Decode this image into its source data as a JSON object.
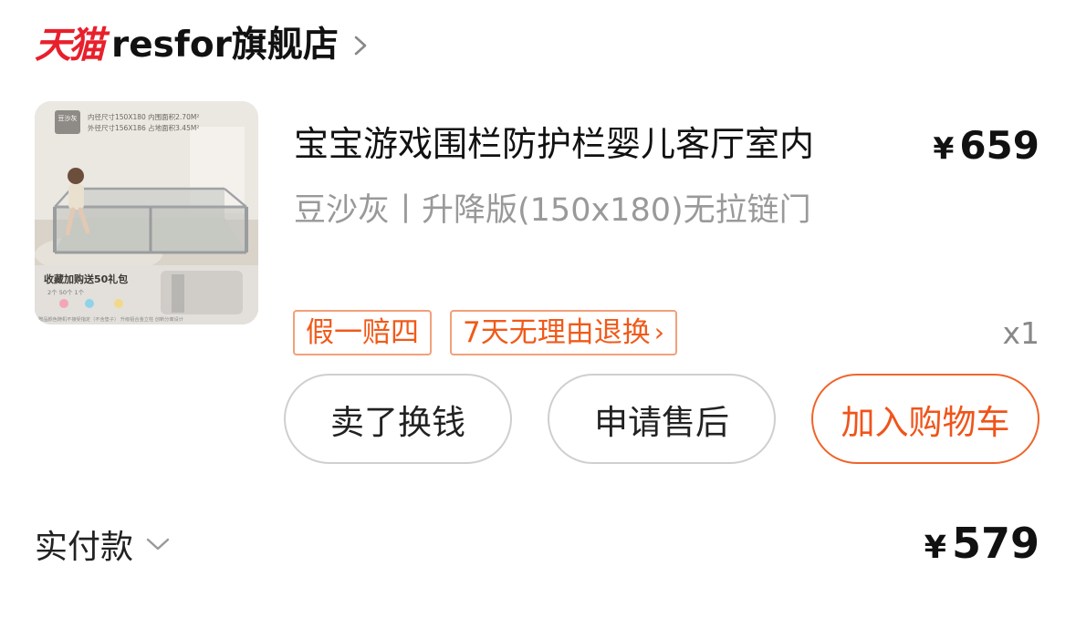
{
  "shop": {
    "platform_logo": "天猫",
    "name": "resfor旗舰店",
    "chevron_icon": "chevron-right-icon"
  },
  "product": {
    "image_overlay": {
      "color_label": "豆沙灰",
      "spec_line_1": "内径尺寸150X180  内围面积2.70M²",
      "spec_line_2": "外径尺寸156X186  占地面积3.45M²",
      "promo": "收藏加购送50礼包",
      "promo_detail": "2个  50个  1个",
      "footnote": "赠品颜色随机不接受指定（不含垫子）  升级铝合金立柱 创新分离设计"
    },
    "title": "宝宝游戏围栏防护栏婴儿客厅室内",
    "currency": "¥",
    "price": "659",
    "spec": "豆沙灰丨升降版(150x180)无拉链门",
    "tags": [
      {
        "label": "假一赔四"
      },
      {
        "label": "7天无理由退换",
        "chevron": "›"
      }
    ],
    "quantity": "x1"
  },
  "actions": {
    "sell_label": "卖了换钱",
    "aftersale_label": "申请售后",
    "cart_label": "加入购物车"
  },
  "payment": {
    "label": "实付款",
    "currency": "¥",
    "amount": "579"
  },
  "colors": {
    "tmall_red": "#e8202c",
    "accent_orange": "#f0541a",
    "tag_border": "#f2a07a",
    "muted_text": "#999999"
  }
}
